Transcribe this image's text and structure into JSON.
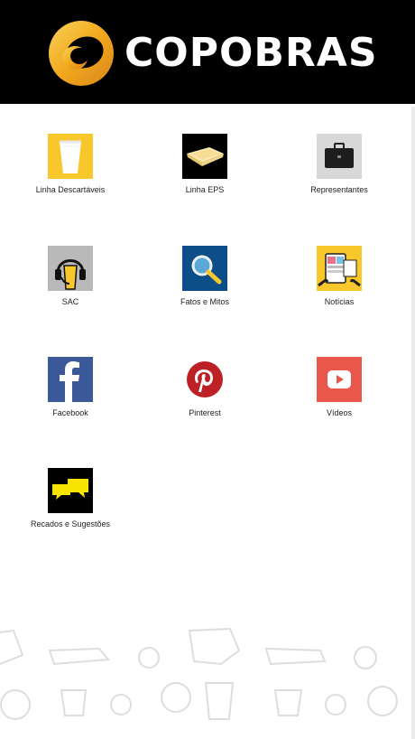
{
  "header": {
    "brand": "COPOBRAS"
  },
  "menu": {
    "items": [
      {
        "label": "Linha Descartáveis",
        "icon": "disposable-cup-icon"
      },
      {
        "label": "Linha EPS",
        "icon": "foam-tray-icon"
      },
      {
        "label": "Representantes",
        "icon": "briefcase-icon"
      },
      {
        "label": "SAC",
        "icon": "headset-icon"
      },
      {
        "label": "Fatos e Mitos",
        "icon": "magnifier-icon"
      },
      {
        "label": "Notícias",
        "icon": "news-phone-icon"
      },
      {
        "label": "Facebook",
        "icon": "facebook-icon"
      },
      {
        "label": "Pinterest",
        "icon": "pinterest-icon"
      },
      {
        "label": "Vídeos",
        "icon": "youtube-icon"
      },
      {
        "label": "Recados e Sugestões",
        "icon": "speech-bubbles-icon"
      }
    ]
  },
  "colors": {
    "header_bg": "#000000",
    "accent_yellow": "#f7c72b",
    "facebook_blue": "#3b5998",
    "pinterest_red": "#bd2126",
    "youtube_red": "#e8574a",
    "fatos_blue": "#0b4e8a"
  }
}
